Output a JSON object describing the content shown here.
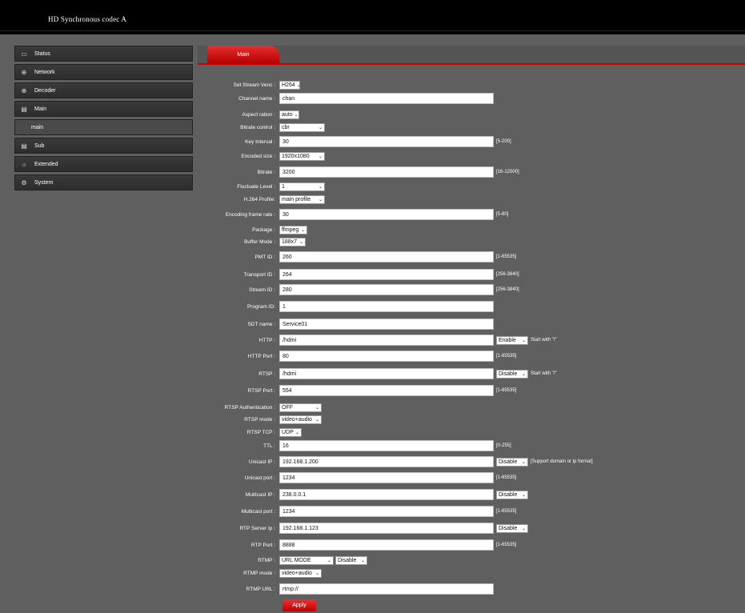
{
  "app_title": "HD Synchronous codec  A",
  "sidebar": {
    "items": [
      {
        "label": "Status",
        "icon": "monitor-icon"
      },
      {
        "label": "Network",
        "icon": "globe-icon"
      },
      {
        "label": "Decoder",
        "icon": "globe-icon"
      },
      {
        "label": "Main",
        "icon": "keyboard-icon"
      },
      {
        "label": "main",
        "icon": "",
        "sub": true
      },
      {
        "label": "Sub",
        "icon": "keyboard-icon"
      },
      {
        "label": "Extended",
        "icon": "sun-icon"
      },
      {
        "label": "System",
        "icon": "gear-icon"
      }
    ]
  },
  "tab": {
    "label": "Main"
  },
  "form": [
    {
      "label": "Set Stream Venc :",
      "kind": "select",
      "value": "H264"
    },
    {
      "label": "Channel name :",
      "kind": "input",
      "value": "chan"
    },
    {
      "label": "Aspect ration :",
      "kind": "select",
      "value": "auto"
    },
    {
      "label": "Bitrate control :",
      "kind": "select",
      "value": "cbr"
    },
    {
      "label": "Key Interval :",
      "kind": "input",
      "value": "30",
      "note": "[5-200]"
    },
    {
      "label": "Encoded size :",
      "kind": "select",
      "value": "1920x1080"
    },
    {
      "label": "Bitrate :",
      "kind": "input",
      "value": "3200",
      "note": "[16-12000]"
    },
    {
      "label": "Fluctuate Level :",
      "kind": "select",
      "value": "1"
    },
    {
      "label": "H.264 Profile:",
      "kind": "select",
      "value": "main profile"
    },
    {
      "label": "Encoding frame rate :",
      "kind": "input",
      "value": "30",
      "note": "[5-60]"
    },
    {
      "label": "Package :",
      "kind": "select",
      "value": "ffmpeg"
    },
    {
      "label": "Buffer Mode :",
      "kind": "select",
      "value": "188x7"
    },
    {
      "label": "PMT ID :",
      "kind": "input",
      "value": "260",
      "note": "[1-65535]"
    },
    {
      "label": "Transport ID :",
      "kind": "input",
      "value": "264",
      "note": "[256-3840]"
    },
    {
      "label": "Stream ID :",
      "kind": "input",
      "value": "280",
      "note": "[256-3840]"
    },
    {
      "label": "Program ID:",
      "kind": "input",
      "value": "1"
    },
    {
      "label": "SDT name :",
      "kind": "input",
      "value": "Service01"
    },
    {
      "label": "HTTP :",
      "kind": "input",
      "value": "/hdmi",
      "sel2": "Enable",
      "note": "Start with \"/\""
    },
    {
      "label": "HTTP Port :",
      "kind": "input",
      "value": "80",
      "note": "[1-65535]"
    },
    {
      "label": "RTSP :",
      "kind": "input",
      "value": "/hdmi",
      "sel2": "Disable",
      "note": "Start with \"/\""
    },
    {
      "label": "RTSP Port :",
      "kind": "input",
      "value": "554",
      "note": "[1-65535]"
    },
    {
      "label": "RTSP Authentication :",
      "kind": "select",
      "value": "OFF"
    },
    {
      "label": "RTSP mode :",
      "kind": "select",
      "value": "video+audio"
    },
    {
      "label": "RTSP TCP :",
      "kind": "select",
      "value": "UDP"
    },
    {
      "label": "TTL :",
      "kind": "input",
      "value": "16",
      "note": "[0-255]"
    },
    {
      "label": "Unicast IP :",
      "kind": "input",
      "value": "192.168.1.200",
      "sel2": "Disable",
      "note": "[Support domain or ip format]"
    },
    {
      "label": "Unicast port :",
      "kind": "input",
      "value": "1234",
      "note": "[1-65535]"
    },
    {
      "label": "Multicast IP :",
      "kind": "input",
      "value": "238.0.0.1",
      "sel2": "Disable"
    },
    {
      "label": "Multicast port :",
      "kind": "input",
      "value": "1234",
      "note": "[1-65535]"
    },
    {
      "label": "RTP Server Ip :",
      "kind": "input",
      "value": "192.168.1.123",
      "sel2": "Disable"
    },
    {
      "label": "RTP Port :",
      "kind": "input",
      "value": "8888",
      "note": "[1-65535]"
    },
    {
      "label": "RTMP :",
      "kind": "select",
      "value": "URL MODE",
      "sel3": "Disable"
    },
    {
      "label": "RTMP mode :",
      "kind": "select",
      "value": "video+audio"
    },
    {
      "label": "RTMP URL :",
      "kind": "input",
      "value": "rtmp://"
    }
  ],
  "apply_label": "Apply"
}
